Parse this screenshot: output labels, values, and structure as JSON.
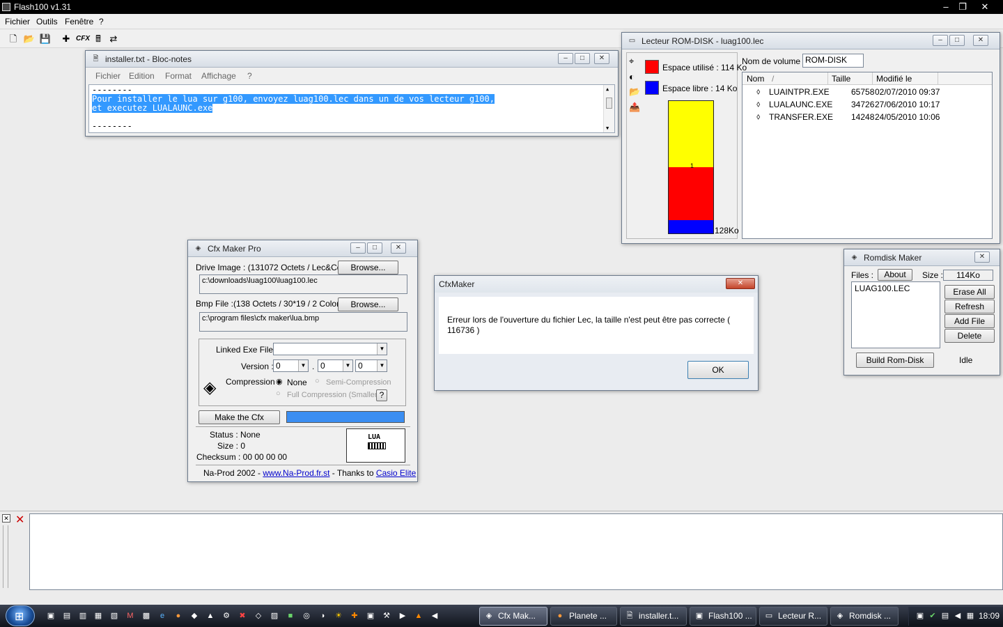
{
  "app": {
    "title": "Flash100 v1.31",
    "menu": [
      "Fichier",
      "Outils",
      "Fenêtre",
      "?"
    ],
    "toolbar_cfx": "CFX"
  },
  "notepad": {
    "title": "installer.txt - Bloc-notes",
    "menu": [
      "Fichier",
      "Edition",
      "Format",
      "Affichage",
      "?"
    ],
    "lines": [
      "--------",
      "Pour installer le lua sur g100, envoyez luag100.lec dans un de vos lecteur g100,",
      "et executez LUALAUNC.exe",
      "",
      "--------"
    ]
  },
  "romdisk_reader": {
    "title": "Lecteur ROM-DISK - luag100.lec",
    "used_label": "Espace utilisé : 114 Ko",
    "free_label": "Espace libre : 14 Ko",
    "bar_marker": "1",
    "capacity_label": "128Ko",
    "volume_label": "Nom de volume :",
    "volume_value": "ROM-DISK",
    "columns": [
      "Nom",
      "/",
      "Taille",
      "Modifié le"
    ],
    "files": [
      {
        "name": "LUAINTPR.EXE",
        "size": "65758",
        "date": "02/07/2010 09:37"
      },
      {
        "name": "LUALAUNC.EXE",
        "size": "34726",
        "date": "27/06/2010 10:17"
      },
      {
        "name": "TRANSFER.EXE",
        "size": "14248",
        "date": "24/05/2010 10:06"
      }
    ],
    "used_fraction": 0.5,
    "red_fraction": 0.4,
    "blue_fraction": 0.1,
    "colors": {
      "used": "#ff0000",
      "free": "#0000ff",
      "yellow": "#ffff00"
    }
  },
  "cfxmaker": {
    "title": "Cfx Maker Pro",
    "drive_image_label": "Drive Image : (131072 Octets / Lec&Cdr)",
    "browse_label": "Browse...",
    "drive_image_path": "c:\\downloads\\luag100\\luag100.lec",
    "bmp_label": "Bmp File :(138 Octets / 30*19 / 2 Colors)",
    "bmp_path": "c:\\program files\\cfx maker\\lua.bmp",
    "linked_exe_label": "Linked Exe File :",
    "version_label": "Version :",
    "version": [
      "0",
      "0",
      "0"
    ],
    "version_sep": ".",
    "compression_label": "Compression :",
    "options": [
      "None",
      "Semi-Compression",
      "Full Compression (Smaller)"
    ],
    "help_button": "?",
    "make_button": "Make the Cfx",
    "status": "Status : None",
    "size": "Size : 0",
    "checksum": "Checksum : 00 00 00 00",
    "preview_text": "LUA",
    "footer_prefix": "Na-Prod 2002  -",
    "footer_link": "www.Na-Prod.fr.st",
    "footer_mid": " - Thanks to ",
    "footer_link2": "Casio Elite"
  },
  "dialog": {
    "title": "CfxMaker",
    "message": "Erreur lors de l'ouverture du fichier Lec, la taille n'est peut être pas correcte ( 116736 )",
    "ok_label": "OK"
  },
  "romdisk_maker": {
    "title": "Romdisk Maker",
    "files_label": "Files :",
    "about_label": "About",
    "size_label": "Size :",
    "size_value": "114Ko",
    "files": [
      "LUAG100.LEC"
    ],
    "buttons": [
      "Erase All",
      "Refresh",
      "Add File",
      "Delete"
    ],
    "build_label": "Build Rom-Disk",
    "status": "Idle"
  },
  "taskbar": {
    "tasks": [
      "Cfx Mak...",
      "Planete ...",
      "installer.t...",
      "Flash100 ...",
      "Lecteur R...",
      "Romdisk ..."
    ],
    "time": "18:09"
  }
}
